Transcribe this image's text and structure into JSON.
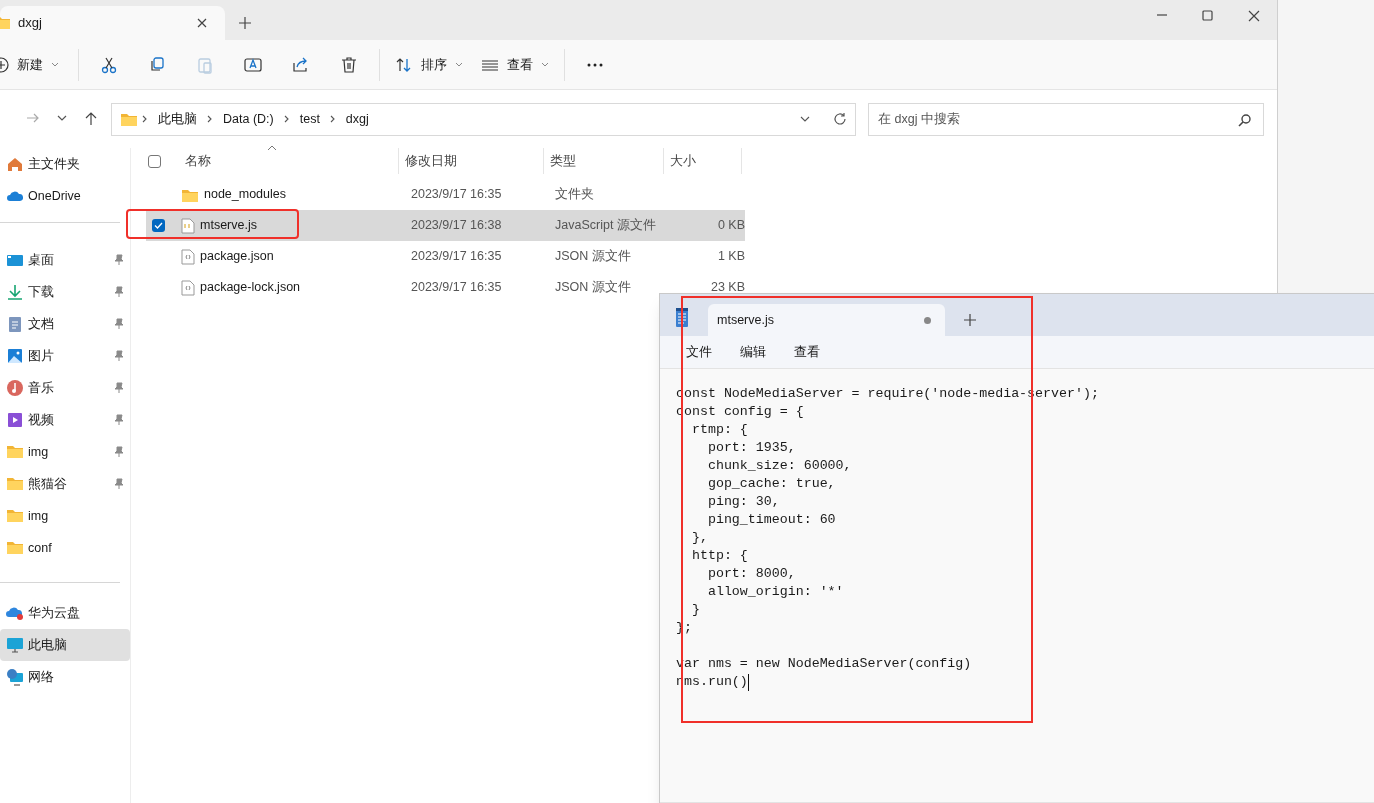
{
  "explorer": {
    "tabs": [
      {
        "label": "dxgj",
        "selected": true
      }
    ],
    "toolbar": [
      {
        "kind": "new",
        "label": "新建"
      },
      {
        "kind": "cut"
      },
      {
        "kind": "copy"
      },
      {
        "kind": "paste",
        "disabled": true
      },
      {
        "kind": "rename"
      },
      {
        "kind": "share"
      },
      {
        "kind": "delete"
      },
      {
        "kind": "sort",
        "label": "排序"
      },
      {
        "kind": "view",
        "label": "查看"
      },
      {
        "kind": "more"
      }
    ],
    "breadcrumb": [
      "此电脑",
      "Data (D:)",
      "test",
      "dxgj"
    ],
    "search": {
      "placeholder": "在 dxgj 中搜索"
    },
    "sidebar": [
      [
        {
          "kind": "home",
          "label": "主文件夹",
          "pinned": false,
          "selected": false
        },
        {
          "kind": "cloud",
          "label": "OneDrive",
          "pinned": false,
          "selected": false
        }
      ],
      [
        {
          "kind": "desktop",
          "label": "桌面",
          "pinned": true,
          "selected": false
        },
        {
          "kind": "download",
          "label": "下载",
          "pinned": true,
          "selected": false
        },
        {
          "kind": "document",
          "label": "文档",
          "pinned": true,
          "selected": false
        },
        {
          "kind": "pictures",
          "label": "图片",
          "pinned": true,
          "selected": false
        },
        {
          "kind": "music",
          "label": "音乐",
          "pinned": true,
          "selected": false
        },
        {
          "kind": "video",
          "label": "视频",
          "pinned": true,
          "selected": false
        },
        {
          "kind": "folder",
          "label": "img",
          "pinned": true,
          "selected": false
        },
        {
          "kind": "folder",
          "label": "熊猫谷",
          "pinned": true,
          "selected": false
        },
        {
          "kind": "folder",
          "label": "img",
          "pinned": false,
          "selected": false
        },
        {
          "kind": "folder",
          "label": "conf",
          "pinned": false,
          "selected": false
        }
      ],
      [
        {
          "kind": "cloudbadge",
          "label": "华为云盘",
          "pinned": false,
          "selected": false
        },
        {
          "kind": "pc",
          "label": "此电脑",
          "pinned": false,
          "selected": true
        },
        {
          "kind": "network",
          "label": "网络",
          "pinned": false,
          "selected": false
        }
      ]
    ],
    "table": {
      "all_checked": false,
      "columns": [
        "名称",
        "修改日期",
        "类型",
        "大小"
      ],
      "rows": [
        {
          "kind": "folder",
          "name": "node_modules",
          "date": "2023/9/17 16:35",
          "type": "文件夹",
          "selected": false
        },
        {
          "kind": "js",
          "name": "mtserve.js",
          "date": "2023/9/17 16:38",
          "type": "JavaScript 源文件",
          "size": "0 KB",
          "selected": true
        },
        {
          "kind": "json",
          "name": "package.json",
          "date": "2023/9/17 16:35",
          "type": "JSON 源文件",
          "size": "1 KB",
          "selected": false
        },
        {
          "kind": "json",
          "name": "package-lock.json",
          "date": "2023/9/17 16:35",
          "type": "JSON 源文件",
          "size": "23 KB",
          "selected": false
        }
      ]
    }
  },
  "notepad": {
    "tabs": [
      {
        "label": "mtserve.js",
        "selected": true,
        "unsaved": true
      }
    ],
    "menu": [
      "文件",
      "编辑",
      "查看"
    ],
    "blocks": [
      [
        "const NodeMediaServer = require('node-media-server');",
        "const config = {",
        "  rtmp: {",
        "    port: 1935,",
        "    chunk_size: 60000,",
        "    gop_cache: true,",
        "    ping: 30,",
        "    ping_timeout: 60",
        "  },",
        "  http: {",
        "    port: 8000,",
        "    allow_origin: '*'",
        "  }",
        "};"
      ],
      [
        "var nms = new NodeMediaServer(config)",
        "nms.run()"
      ]
    ]
  }
}
